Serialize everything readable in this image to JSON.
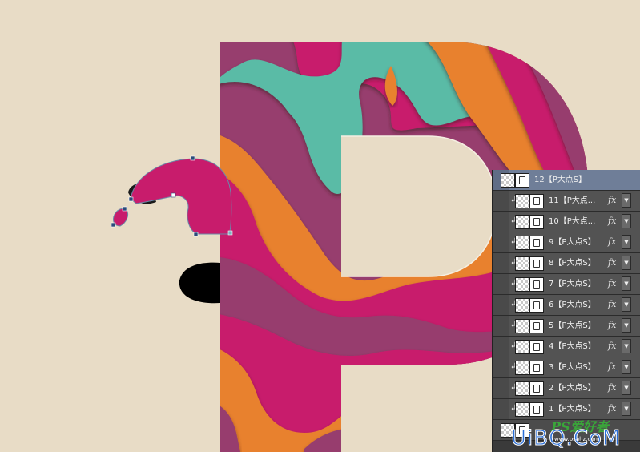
{
  "colors": {
    "background": "#e8dcc6",
    "purple": "#973e6e",
    "magenta": "#c81c6c",
    "teal": "#5abba6",
    "orange": "#e8812f",
    "panel_row": "#535353",
    "panel_selected": "#6f7e98"
  },
  "layers_panel": {
    "rows": [
      {
        "name": "12【P大点S】",
        "selected": true,
        "clip": "",
        "fx": ""
      },
      {
        "name": "11【P大点...",
        "selected": false,
        "clip": "↲",
        "fx": "fx"
      },
      {
        "name": "10【P大点...",
        "selected": false,
        "clip": "↲",
        "fx": "fx"
      },
      {
        "name": "9【P大点S】",
        "selected": false,
        "clip": "↲",
        "fx": "fx"
      },
      {
        "name": "8【P大点S】",
        "selected": false,
        "clip": "↲",
        "fx": "fx"
      },
      {
        "name": "7【P大点S】",
        "selected": false,
        "clip": "↲",
        "fx": "fx"
      },
      {
        "name": "6【P大点S】",
        "selected": false,
        "clip": "↲",
        "fx": "fx"
      },
      {
        "name": "5【P大点S】",
        "selected": false,
        "clip": "↲",
        "fx": "fx"
      },
      {
        "name": "4【P大点S】",
        "selected": false,
        "clip": "↲",
        "fx": "fx"
      },
      {
        "name": "3【P大点S】",
        "selected": false,
        "clip": "↲",
        "fx": "fx"
      },
      {
        "name": "2【P大点S】",
        "selected": false,
        "clip": "↲",
        "fx": "fx"
      },
      {
        "name": "1【P大点S】",
        "selected": false,
        "clip": "↲",
        "fx": "fx"
      }
    ],
    "arrow_glyph": "▼"
  },
  "watermark": {
    "brand": "PS爱好者",
    "site": "www.psahz.com",
    "logo": "UiBQ.CoM"
  },
  "icons": {
    "clip": "clipping-mask-icon",
    "fx": "layer-effects-icon",
    "thumb": "layer-thumbnail-icon",
    "mask": "vector-mask-thumbnail-icon"
  }
}
